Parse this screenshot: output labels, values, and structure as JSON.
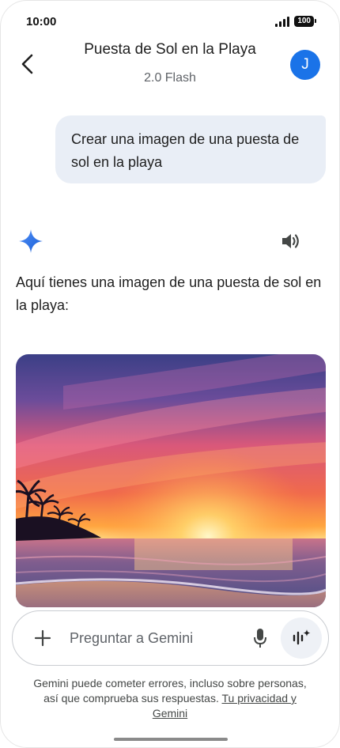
{
  "status": {
    "time": "10:00",
    "battery": "100"
  },
  "header": {
    "title": "Puesta de Sol en la Playa",
    "subtitle": "2.0 Flash",
    "avatar_letter": "J"
  },
  "conversation": {
    "user_message": "Crear una imagen de una puesta de sol en la playa",
    "response_text": "Aquí tienes una imagen de una puesta de sol en la playa:"
  },
  "input": {
    "placeholder": "Preguntar a Gemini"
  },
  "disclaimer": {
    "text": "Gemini puede cometer errores, incluso sobre personas, así que comprueba sus respuestas.",
    "link": "Tu privacidad y Gemini"
  },
  "icons": {
    "back": "arrow-back-icon",
    "avatar": "user-avatar",
    "gemini": "gemini-sparkle-icon",
    "speaker": "speaker-icon",
    "add": "plus-icon",
    "mic": "microphone-icon",
    "live": "gemini-live-icon"
  },
  "colors": {
    "accent": "#1a73e8",
    "bubble": "#e9eef6"
  }
}
